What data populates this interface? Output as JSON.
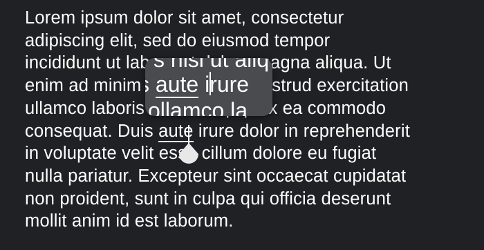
{
  "paragraph": {
    "lines": [
      "Lorem ipsum dolor sit amet, consectetur",
      "adipiscing elit, sed do eiusmod tempor",
      "incididunt ut labore et dolore magna aliqua. Ut",
      "enim ad minim veniam, quis nostrud exercitation",
      "ullamco la",
      "boris nisi ut aliquip ex ea commodo",
      "consequat. Duis ",
      "aute",
      " irure dolor in reprehenderit",
      "in voluptate velit esse cillum dolore eu fugiat",
      "nulla pariatur. Excepteur sint occaecat cupidatat",
      "non proident, sunt in culpa qui officia deserunt",
      "mollit anim id est laborum."
    ]
  },
  "magnifier": {
    "top": "s nisi ut aliq",
    "mid_before": "s ",
    "mid_word": "aute",
    "mid_after": " irure",
    "bottom": "ollamco la"
  }
}
